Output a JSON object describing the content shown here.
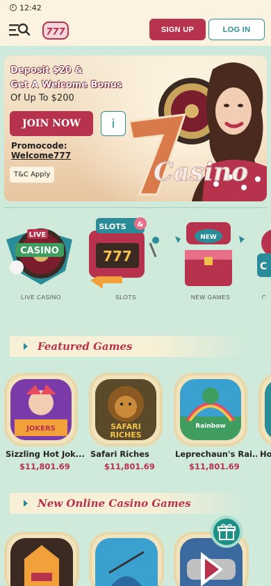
{
  "status_bar": {
    "time": "12:42"
  },
  "header": {
    "signup_label": "SIGN UP",
    "login_label": "LOG IN"
  },
  "hero": {
    "line1": "Deposit $20 &",
    "line2": "Get A Welcome Bonus",
    "line3": "Of Up To $200",
    "join_label": "JOIN NOW",
    "info_label": "i",
    "promocode_label": "Promocode:",
    "promocode_value": "Welcome777",
    "tc_label": "T&C Apply"
  },
  "categories": [
    {
      "label": "LIVE CASINO"
    },
    {
      "label": "SLOTS"
    },
    {
      "label": "NEW GAMES"
    },
    {
      "label": "C"
    }
  ],
  "sections": {
    "featured_title": "Featured Games",
    "new_title": "New Online Casino Games"
  },
  "featured_games": [
    {
      "name": "Sizzling Hot Jok...",
      "price": "$11,801.69"
    },
    {
      "name": "Safari Riches",
      "price": "$11,801.69"
    },
    {
      "name": "Leprechaun's Rai...",
      "price": "$11,801.69"
    },
    {
      "name": "Hol",
      "price": ""
    }
  ],
  "colors": {
    "brand_red": "#b7324c",
    "brand_teal": "#2a8c98",
    "cream": "#fbf3df",
    "mint": "#cfe9da"
  }
}
